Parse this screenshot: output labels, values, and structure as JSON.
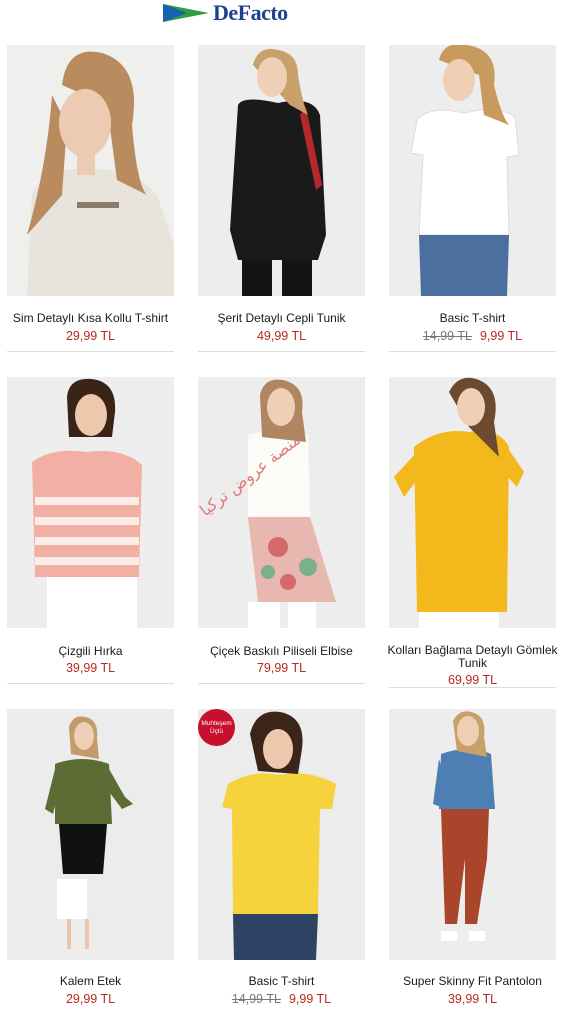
{
  "brand": {
    "name": "DeFacto",
    "logo_colors": [
      "#1a5fb4",
      "#2e9e3e",
      "#1f3f8f"
    ]
  },
  "products": [
    {
      "name": "Sim Detaylı Kısa Kollu T-shirt",
      "price": "29,99 TL",
      "old_price": ""
    },
    {
      "name": "Şerit Detaylı Cepli Tunik",
      "price": "49,99 TL",
      "old_price": ""
    },
    {
      "name": "Basic T-shirt",
      "price": "9,99 TL",
      "old_price": "14,99 TL"
    },
    {
      "name": "Çizgili Hırka",
      "price": "39,99 TL",
      "old_price": ""
    },
    {
      "name": "Çiçek Baskılı Piliseli Elbise",
      "price": "79,99 TL",
      "old_price": ""
    },
    {
      "name": "Kolları Bağlama Detaylı Gömlek Tunik",
      "price": "69,99 TL",
      "old_price": ""
    },
    {
      "name": "Kalem Etek",
      "price": "29,99 TL",
      "old_price": ""
    },
    {
      "name": "Basic T-shirt",
      "price": "9,99 TL",
      "old_price": "14,99 TL"
    },
    {
      "name": "Super Skinny Fit Pantolon",
      "price": "39,99 TL",
      "old_price": ""
    }
  ],
  "badge": {
    "line1": "Muhteşem",
    "line2": "Üçlü"
  },
  "watermark": "منصة عروض تركيا",
  "colors": {
    "price": "#b52a1c",
    "old_price": "#777777",
    "badge": "#c8102e"
  }
}
